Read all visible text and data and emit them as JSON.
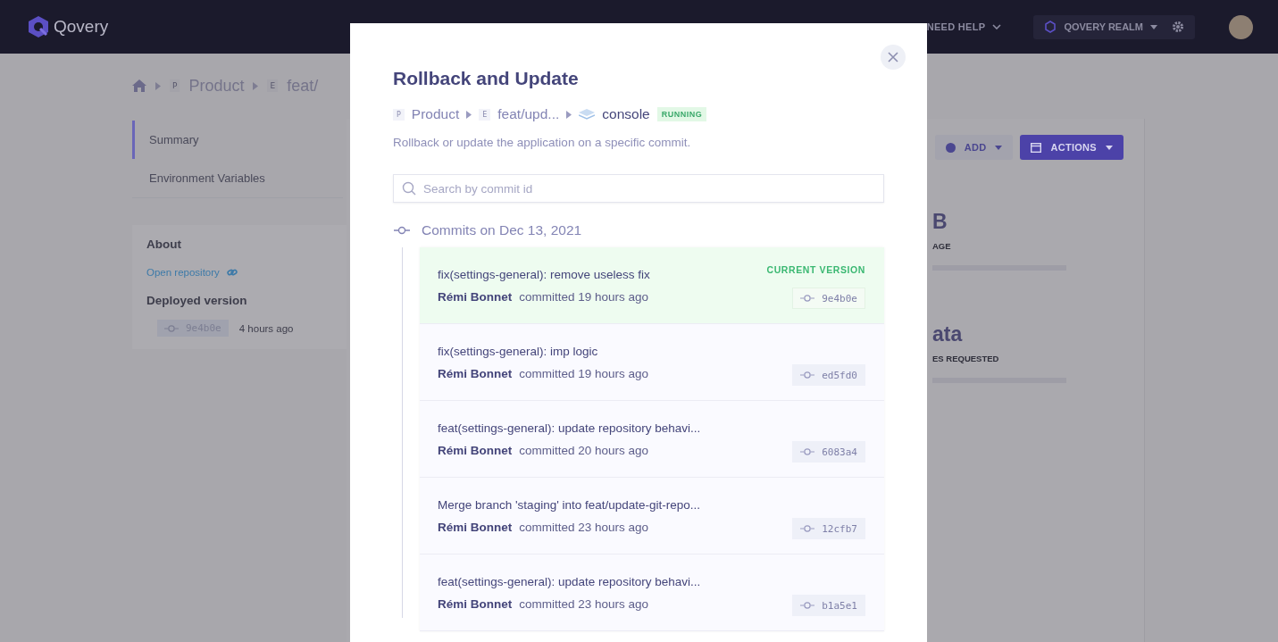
{
  "header": {
    "logo": "Qovery",
    "help": "NEED HELP",
    "org": "QOVERY REALM"
  },
  "breadcrumb": [
    {
      "badge": "P",
      "label": "Product"
    },
    {
      "badge": "E",
      "label": "feat/"
    }
  ],
  "sidebar": {
    "items": [
      {
        "label": "Summary",
        "selected": true
      },
      {
        "label": "Environment Variables",
        "selected": false
      }
    ]
  },
  "about": {
    "title": "About",
    "link": "Open repository",
    "deployed_title": "Deployed version",
    "commit": "9e4b0e",
    "time": "4 hours ago"
  },
  "toolbar": [
    {
      "label": "ADD",
      "kind": "secondary"
    },
    {
      "label": "ACTIONS",
      "kind": "primary"
    }
  ],
  "stats": [
    {
      "value": "B",
      "label": "AGE"
    },
    {
      "value": "ata",
      "label": "ES REQUESTED"
    }
  ],
  "modal": {
    "title": "Rollback and Update",
    "path": [
      {
        "kind": "project",
        "badge": "P",
        "label": "Product"
      },
      {
        "kind": "environment",
        "badge": "E",
        "label": "feat/upd..."
      },
      {
        "kind": "application",
        "label": "console",
        "status": "RUNNING"
      }
    ],
    "description": "Rollback or update the application on a specific commit.",
    "search": {
      "placeholder": "Search by commit id"
    },
    "group_title": "Commits on Dec 13, 2021",
    "commits": [
      {
        "message": "fix(settings-general): remove useless fix",
        "author": "Rémi Bonnet",
        "time": "committed 19 hours ago",
        "hash": "9e4b0e",
        "current": true,
        "tag": "CURRENT VERSION"
      },
      {
        "message": "fix(settings-general): imp logic",
        "author": "Rémi Bonnet",
        "time": "committed 19 hours ago",
        "hash": "ed5fd0",
        "current": false
      },
      {
        "message": "feat(settings-general): update repository behavi...",
        "author": "Rémi Bonnet",
        "time": "committed 20 hours ago",
        "hash": "6083a4",
        "current": false
      },
      {
        "message": "Merge branch 'staging' into feat/update-git-repo...",
        "author": "Rémi Bonnet",
        "time": "committed 23 hours ago",
        "hash": "12cfb7",
        "current": false
      },
      {
        "message": "feat(settings-general): update repository behavi...",
        "author": "Rémi Bonnet",
        "time": "committed 23 hours ago",
        "hash": "b1a5e1",
        "current": false
      }
    ]
  }
}
